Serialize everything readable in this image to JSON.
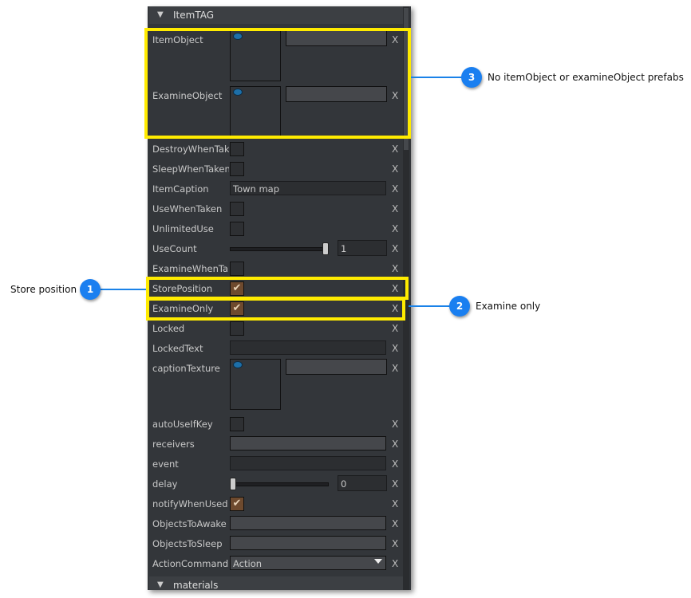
{
  "inspector": {
    "section_title": "ItemTAG",
    "footer_section_title": "materials",
    "clear_label": "X",
    "rows": [
      {
        "label": "ItemObject",
        "type": "object"
      },
      {
        "label": "ExamineObject",
        "type": "object"
      },
      {
        "label": "DestroyWhenTake",
        "type": "checkbox",
        "checked": false
      },
      {
        "label": "SleepWhenTaken",
        "type": "checkbox",
        "checked": false
      },
      {
        "label": "ItemCaption",
        "type": "text",
        "value": "Town map"
      },
      {
        "label": "UseWhenTaken",
        "type": "checkbox",
        "checked": false
      },
      {
        "label": "UnlimitedUse",
        "type": "checkbox",
        "checked": false
      },
      {
        "label": "UseCount",
        "type": "slider",
        "value": "1",
        "fraction": 1
      },
      {
        "label": "ExamineWhenTak",
        "type": "checkbox",
        "checked": false
      },
      {
        "label": "StorePosition",
        "type": "checkbox",
        "checked": true
      },
      {
        "label": "ExamineOnly",
        "type": "checkbox",
        "checked": true
      },
      {
        "label": "Locked",
        "type": "checkbox",
        "checked": false
      },
      {
        "label": "LockedText",
        "type": "text",
        "value": ""
      },
      {
        "label": "captionTexture",
        "type": "object"
      },
      {
        "label": "autoUseIfKey",
        "type": "checkbox",
        "checked": false
      },
      {
        "label": "receivers",
        "type": "ref",
        "value": ""
      },
      {
        "label": "event",
        "type": "text",
        "value": ""
      },
      {
        "label": "delay",
        "type": "slider",
        "value": "0",
        "fraction": 0
      },
      {
        "label": "notifyWhenUsed",
        "type": "checkbox",
        "checked": true
      },
      {
        "label": "ObjectsToAwake",
        "type": "ref",
        "value": ""
      },
      {
        "label": "ObjectsToSleep",
        "type": "ref",
        "value": ""
      },
      {
        "label": "ActionCommand",
        "type": "dropdown",
        "value": "Action"
      }
    ]
  },
  "callouts": [
    {
      "number": "1",
      "text": "Store position"
    },
    {
      "number": "2",
      "text": "Examine only"
    },
    {
      "number": "3",
      "text": "No itemObject or examineObject prefabs"
    }
  ],
  "colors": {
    "highlight": "#ffeb00",
    "callout": "#1a7ff0",
    "checkbox_checked": "#6e4a2e"
  }
}
